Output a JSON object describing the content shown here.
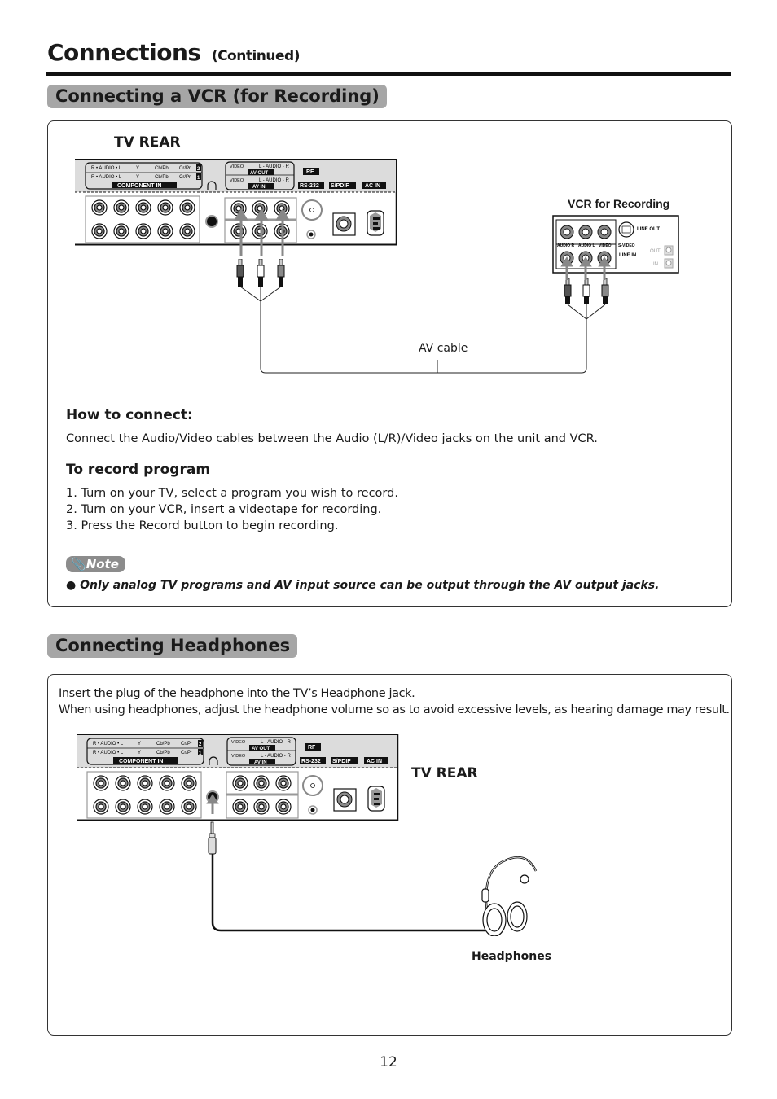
{
  "header": {
    "title": "Connections",
    "subtitle": "(Continued)"
  },
  "vcr_section": {
    "heading": "Connecting a VCR (for Recording)",
    "tv_rear_label": "TV REAR",
    "vcr_label": "VCR for Recording",
    "cable_label": "AV cable",
    "tv_panel": {
      "component_row2": [
        "R • AUDIO • L",
        "Y",
        "Cb/Pb",
        "Cr/Pr",
        "2"
      ],
      "component_row1": [
        "R • AUDIO • L",
        "Y",
        "Cb/Pb",
        "Cr/Pr",
        "1"
      ],
      "component_in": "COMPONENT IN",
      "av_out_labels": [
        "VIDEO",
        "L - AUDIO - R"
      ],
      "av_out": "AV OUT",
      "av_in_labels": [
        "VIDEO",
        "L - AUDIO - R"
      ],
      "av_in": "AV IN",
      "rf": "RF",
      "rs232": "RS-232",
      "spdif": "S/PDIF",
      "ac_in": "AC IN"
    },
    "vcr_panel": {
      "line_out": "LINE OUT",
      "line_in": "LINE IN",
      "svideo": "S-VIDEO",
      "jack_labels": [
        "AUDIO R",
        "AUDIO L",
        "VIDEO"
      ],
      "out": "OUT",
      "in": "IN"
    },
    "how_to_connect": {
      "heading": "How to connect:",
      "text": "Connect the Audio/Video cables between the Audio (L/R)/Video jacks on the unit and VCR."
    },
    "record": {
      "heading": "To record program",
      "steps": [
        "1. Turn on your TV, select a program you wish to record.",
        "2. Turn on your VCR, insert a videotape for recording.",
        "3. Press the Record button to begin recording."
      ]
    },
    "note": {
      "badge": "Note",
      "text": "Only analog TV programs and AV input source can be output through the AV output jacks."
    }
  },
  "headphones_section": {
    "heading": "Connecting Headphones",
    "lines": [
      "Insert the plug of the headphone into the TV’s Headphone jack.",
      "When using headphones, adjust the headphone volume so as to avoid excessive levels, as hearing damage may result."
    ],
    "tv_rear_label": "TV REAR",
    "headphones_label": "Headphones"
  },
  "footer": {
    "page_number": "12"
  }
}
